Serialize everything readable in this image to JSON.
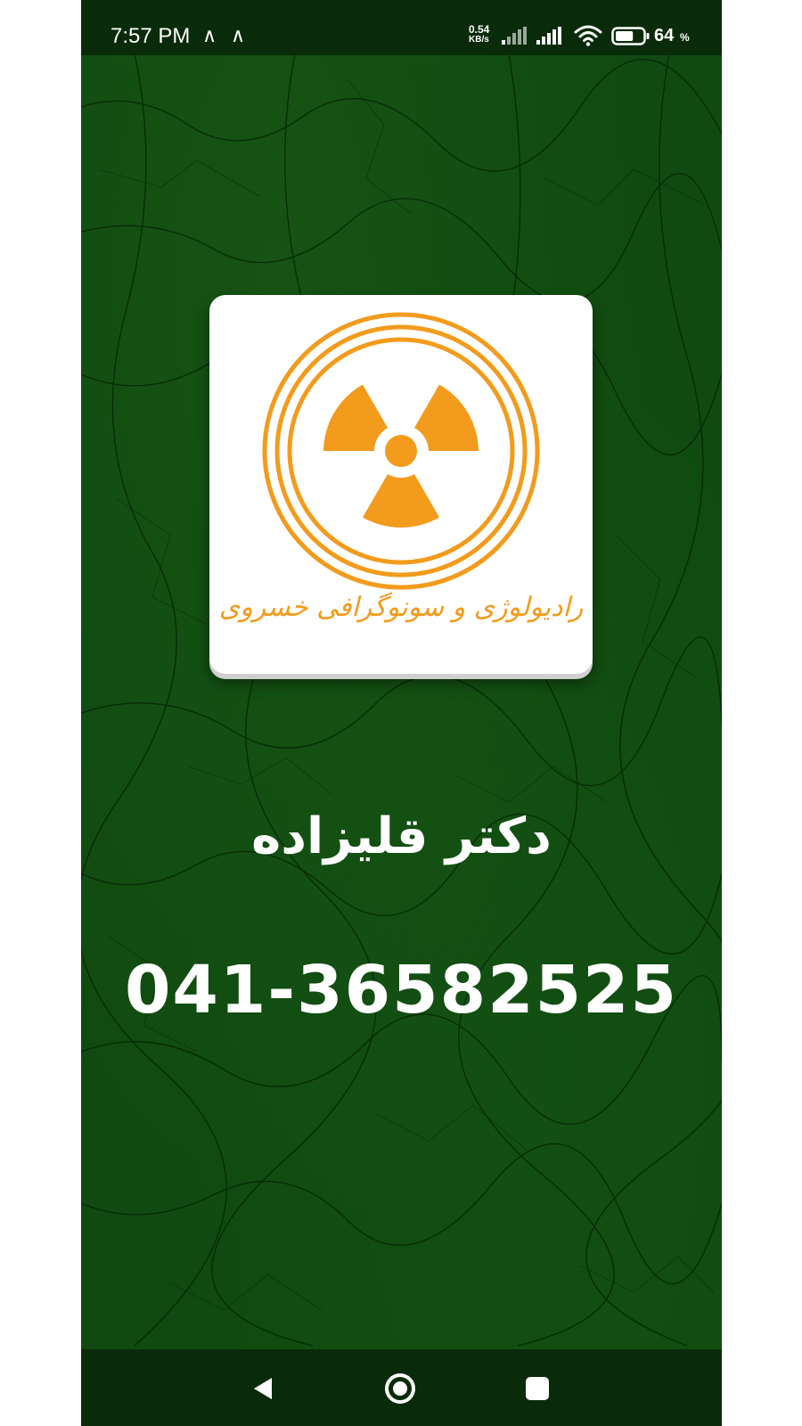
{
  "status_bar": {
    "time": "7:57 PM",
    "notification_icons": [
      "∧",
      "∧"
    ],
    "net_speed_value": "0.54",
    "net_speed_unit": "KB/s",
    "battery_percent": "64",
    "battery_percent_sign": "%",
    "battery_level": 0.64,
    "icons": [
      "signal-bars-icon",
      "signal-bars-icon",
      "wifi-icon",
      "battery-icon"
    ]
  },
  "logo": {
    "clinic_name": "رادیولوژی و سونوگرافی خسروی",
    "symbol": "radiation-trefoil-icon",
    "color": "#f39b1c"
  },
  "content": {
    "doctor_name": "دکتر قلیزاده",
    "phone_number": "041-36582525"
  },
  "nav_bar": {
    "buttons": [
      "back-icon",
      "home-icon",
      "recents-icon"
    ]
  },
  "colors": {
    "background": "#104a10",
    "bars": "#0a2b0a",
    "text": "#ffffff",
    "accent": "#f39b1c"
  }
}
